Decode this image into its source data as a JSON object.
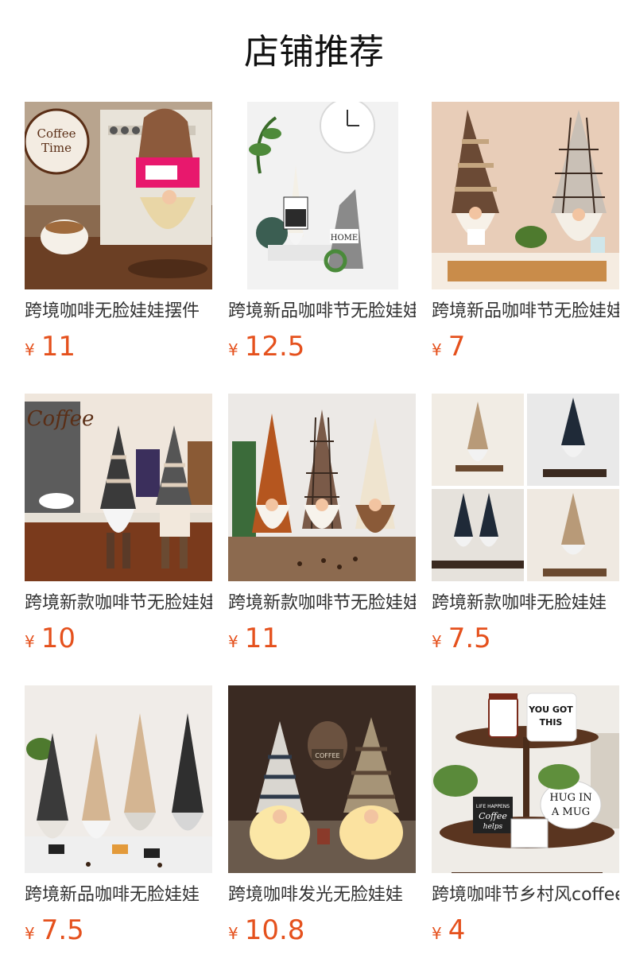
{
  "section": {
    "title": "店铺推荐"
  },
  "currency_symbol": "¥",
  "colors": {
    "price": "#e5511d",
    "title": "#111111",
    "name": "#333333"
  },
  "products": [
    {
      "name": "跨境咖啡无脸娃娃摆件",
      "price": "11",
      "image": "gnome-coffee-machine-blonde-beard",
      "badge_text": [
        "Coffee",
        "Time"
      ]
    },
    {
      "name": "跨境新品咖啡节无脸娃娃",
      "price": "12.5",
      "image": "gnome-pair-white-clock-plant",
      "badge_text": [
        "HOME"
      ]
    },
    {
      "name": "跨境新品咖啡节无脸娃娃",
      "price": "7",
      "image": "gnome-pair-striped-plaid-hats"
    },
    {
      "name": "跨境新款咖啡节无脸娃娃",
      "price": "10",
      "image": "gnome-pair-coffee-shelf",
      "badge_text": [
        "Coffee"
      ]
    },
    {
      "name": "跨境新款咖啡节无脸娃娃",
      "price": "11",
      "image": "gnome-trio-brown-plaid-cream"
    },
    {
      "name": "跨境新款咖啡无脸娃娃",
      "price": "7.5",
      "image": "gnome-collage-four-panels"
    },
    {
      "name": "跨境新品咖啡无脸娃娃",
      "price": "7.5",
      "image": "gnome-four-sitting-legs"
    },
    {
      "name": "跨境咖啡发光无脸娃娃",
      "price": "10.8",
      "image": "gnome-pair-glowing-beards",
      "badge_text": [
        "COFFEE"
      ]
    },
    {
      "name": "跨境咖啡节乡村风coffee",
      "price": "4",
      "image": "tiered-tray-coffee-signs",
      "badge_text": [
        "YOU GOT",
        "THIS",
        "HUG IN",
        "A MUG",
        "LIFE HAPPENS",
        "Coffee",
        "helps"
      ]
    }
  ]
}
